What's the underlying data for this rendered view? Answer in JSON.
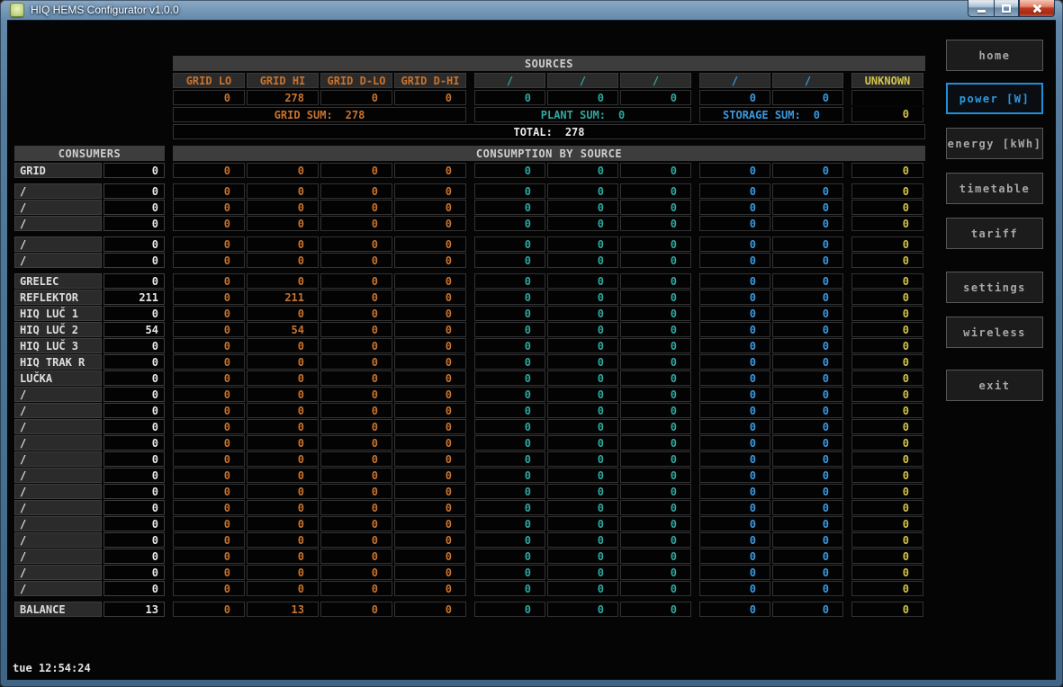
{
  "window": {
    "title": "HIQ HEMS Configurator v1.0.0",
    "controls": [
      "minimize",
      "maximize",
      "close"
    ]
  },
  "statusbar": {
    "clock": "tue 12:54:24"
  },
  "colors": {
    "grid_accent": "#c8732e",
    "plant_accent": "#2fa89f",
    "storage_accent": "#3a9ae0",
    "unknown_accent": "#d3c44a",
    "active_button_accent": "#1f8fd8"
  },
  "nav": {
    "items": [
      {
        "label": "home",
        "active": false
      },
      {
        "label": "power [W]",
        "active": true
      },
      {
        "label": "energy [kWh]",
        "active": false
      },
      {
        "label": "timetable",
        "active": false
      },
      {
        "label": "tariff",
        "active": false
      },
      {
        "label": "settings",
        "active": false
      },
      {
        "label": "wireless",
        "active": false
      },
      {
        "label": "exit",
        "active": false
      }
    ]
  },
  "sources": {
    "title": "SOURCES",
    "columns": [
      "GRID LO",
      "GRID HI",
      "GRID D-LO",
      "GRID D-HI",
      "/",
      "/",
      "/",
      "/",
      "/",
      "UNKNOWN"
    ],
    "column_groups": [
      "grid",
      "grid",
      "grid",
      "grid",
      "plant",
      "plant",
      "plant",
      "storage",
      "storage",
      "unknown"
    ],
    "values": [
      "0",
      "278",
      "0",
      "0",
      "0",
      "0",
      "0",
      "0",
      "0",
      ""
    ],
    "sums": {
      "grid_label": "GRID SUM:",
      "grid": "278",
      "plant_label": "PLANT SUM:",
      "plant": "0",
      "storage_label": "STORAGE SUM:",
      "storage": "0",
      "unknown": "0"
    },
    "total_label": "TOTAL:",
    "total": "278"
  },
  "consumers": {
    "title": "CONSUMERS",
    "matrix_title": "CONSUMPTION BY SOURCE",
    "rows": [
      {
        "name": "GRID",
        "value": "0",
        "cells": [
          "0",
          "0",
          "0",
          "0",
          "0",
          "0",
          "0",
          "0",
          "0",
          "0"
        ],
        "gap_after": true
      },
      {
        "name": "/",
        "value": "0",
        "cells": [
          "0",
          "0",
          "0",
          "0",
          "0",
          "0",
          "0",
          "0",
          "0",
          "0"
        ]
      },
      {
        "name": "/",
        "value": "0",
        "cells": [
          "0",
          "0",
          "0",
          "0",
          "0",
          "0",
          "0",
          "0",
          "0",
          "0"
        ]
      },
      {
        "name": "/",
        "value": "0",
        "cells": [
          "0",
          "0",
          "0",
          "0",
          "0",
          "0",
          "0",
          "0",
          "0",
          "0"
        ],
        "gap_after": true
      },
      {
        "name": "/",
        "value": "0",
        "cells": [
          "0",
          "0",
          "0",
          "0",
          "0",
          "0",
          "0",
          "0",
          "0",
          "0"
        ]
      },
      {
        "name": "/",
        "value": "0",
        "cells": [
          "0",
          "0",
          "0",
          "0",
          "0",
          "0",
          "0",
          "0",
          "0",
          "0"
        ],
        "gap_after": true
      },
      {
        "name": "GRELEC",
        "value": "0",
        "cells": [
          "0",
          "0",
          "0",
          "0",
          "0",
          "0",
          "0",
          "0",
          "0",
          "0"
        ]
      },
      {
        "name": "REFLEKTOR",
        "value": "211",
        "cells": [
          "0",
          "211",
          "0",
          "0",
          "0",
          "0",
          "0",
          "0",
          "0",
          "0"
        ]
      },
      {
        "name": "HIQ LUČ 1",
        "value": "0",
        "cells": [
          "0",
          "0",
          "0",
          "0",
          "0",
          "0",
          "0",
          "0",
          "0",
          "0"
        ]
      },
      {
        "name": "HIQ LUČ 2",
        "value": "54",
        "cells": [
          "0",
          "54",
          "0",
          "0",
          "0",
          "0",
          "0",
          "0",
          "0",
          "0"
        ]
      },
      {
        "name": "HIQ LUČ 3",
        "value": "0",
        "cells": [
          "0",
          "0",
          "0",
          "0",
          "0",
          "0",
          "0",
          "0",
          "0",
          "0"
        ]
      },
      {
        "name": "HIQ TRAK R",
        "value": "0",
        "cells": [
          "0",
          "0",
          "0",
          "0",
          "0",
          "0",
          "0",
          "0",
          "0",
          "0"
        ]
      },
      {
        "name": "LUČKA",
        "value": "0",
        "cells": [
          "0",
          "0",
          "0",
          "0",
          "0",
          "0",
          "0",
          "0",
          "0",
          "0"
        ]
      },
      {
        "name": "/",
        "value": "0",
        "cells": [
          "0",
          "0",
          "0",
          "0",
          "0",
          "0",
          "0",
          "0",
          "0",
          "0"
        ]
      },
      {
        "name": "/",
        "value": "0",
        "cells": [
          "0",
          "0",
          "0",
          "0",
          "0",
          "0",
          "0",
          "0",
          "0",
          "0"
        ]
      },
      {
        "name": "/",
        "value": "0",
        "cells": [
          "0",
          "0",
          "0",
          "0",
          "0",
          "0",
          "0",
          "0",
          "0",
          "0"
        ]
      },
      {
        "name": "/",
        "value": "0",
        "cells": [
          "0",
          "0",
          "0",
          "0",
          "0",
          "0",
          "0",
          "0",
          "0",
          "0"
        ]
      },
      {
        "name": "/",
        "value": "0",
        "cells": [
          "0",
          "0",
          "0",
          "0",
          "0",
          "0",
          "0",
          "0",
          "0",
          "0"
        ]
      },
      {
        "name": "/",
        "value": "0",
        "cells": [
          "0",
          "0",
          "0",
          "0",
          "0",
          "0",
          "0",
          "0",
          "0",
          "0"
        ]
      },
      {
        "name": "/",
        "value": "0",
        "cells": [
          "0",
          "0",
          "0",
          "0",
          "0",
          "0",
          "0",
          "0",
          "0",
          "0"
        ]
      },
      {
        "name": "/",
        "value": "0",
        "cells": [
          "0",
          "0",
          "0",
          "0",
          "0",
          "0",
          "0",
          "0",
          "0",
          "0"
        ]
      },
      {
        "name": "/",
        "value": "0",
        "cells": [
          "0",
          "0",
          "0",
          "0",
          "0",
          "0",
          "0",
          "0",
          "0",
          "0"
        ]
      },
      {
        "name": "/",
        "value": "0",
        "cells": [
          "0",
          "0",
          "0",
          "0",
          "0",
          "0",
          "0",
          "0",
          "0",
          "0"
        ]
      },
      {
        "name": "/",
        "value": "0",
        "cells": [
          "0",
          "0",
          "0",
          "0",
          "0",
          "0",
          "0",
          "0",
          "0",
          "0"
        ]
      },
      {
        "name": "/",
        "value": "0",
        "cells": [
          "0",
          "0",
          "0",
          "0",
          "0",
          "0",
          "0",
          "0",
          "0",
          "0"
        ]
      },
      {
        "name": "/",
        "value": "0",
        "cells": [
          "0",
          "0",
          "0",
          "0",
          "0",
          "0",
          "0",
          "0",
          "0",
          "0"
        ],
        "gap_after": true
      },
      {
        "name": "BALANCE",
        "value": "13",
        "cells": [
          "0",
          "13",
          "0",
          "0",
          "0",
          "0",
          "0",
          "0",
          "0",
          "0"
        ]
      }
    ]
  }
}
